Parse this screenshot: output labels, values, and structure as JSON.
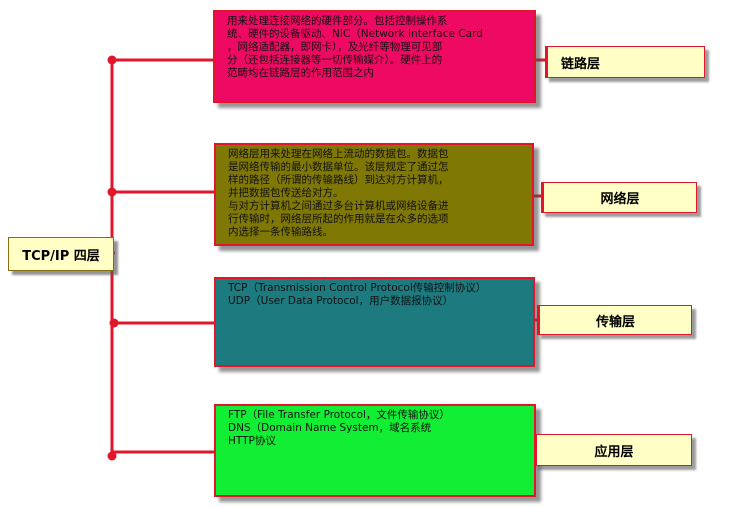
{
  "root": {
    "label": "TCP/IP 四层"
  },
  "layers": [
    {
      "id": "link",
      "label": "链路层",
      "fill": "#ee0a62",
      "description": [
        "用来处理连接网络的硬件部分。包括控制操作系",
        "统、硬件的设备驱动、NIC（Network Interface Card",
        "，网络适配器，即网卡），及光纤等物理可见部",
        "分（还包括连接器等一切传输媒介）。硬件上的",
        "范畴均在链路层的作用范围之内"
      ]
    },
    {
      "id": "network",
      "label": "网络层",
      "fill": "#807804",
      "description": [
        "网络层用来处理在网络上流动的数据包。数据包",
        "是网络传输的最小数据单位。该层规定了通过怎",
        "样的路径（所谓的传输路线）到达对方计算机，",
        "并把数据包传送给对方。",
        "与对方计算机之间通过多台计算机或网络设备进",
        "行传输时，网络层所起的作用就是在众多的选项",
        "内选择一条传输路线。"
      ]
    },
    {
      "id": "transport",
      "label": "传输层",
      "fill": "#1d7b7f",
      "description": [
        "TCP（Transmission Control Protocol传输控制协议）",
        "UDP（User Data Protocol，用户数据报协议）"
      ]
    },
    {
      "id": "application",
      "label": "应用层",
      "fill": "#12ee34",
      "description": [
        "FTP（File Transfer Protocol，文件传输协议）",
        "DNS（Domain Name System，域名系统",
        "HTTP协议"
      ]
    }
  ],
  "connector_color": "#e1162a"
}
